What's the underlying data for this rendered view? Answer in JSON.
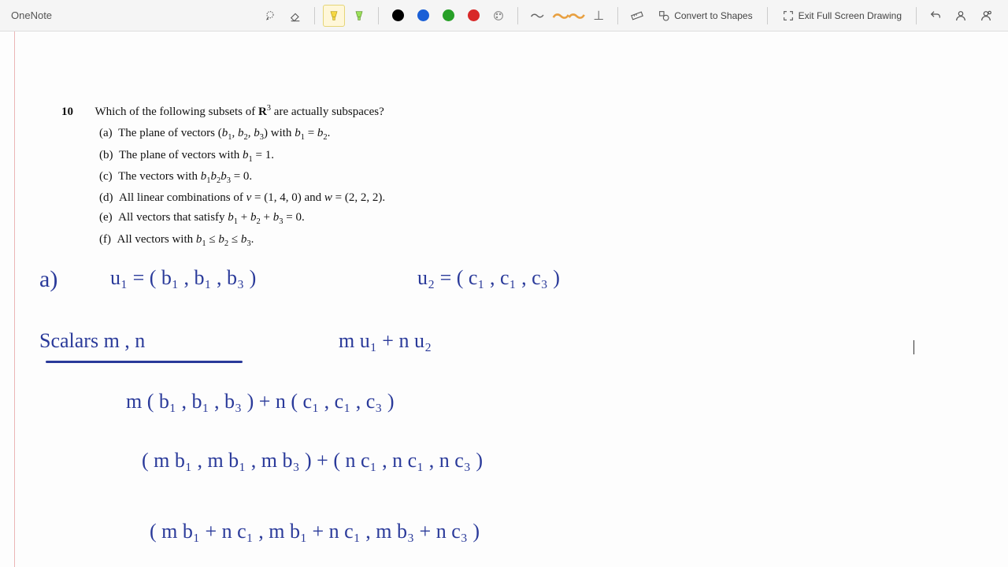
{
  "app": {
    "name": "OneNote"
  },
  "toolbar": {
    "lasso": "Lasso Select",
    "eraser": "Eraser",
    "hl1": "Highlighter Yellow",
    "hl2": "Highlighter Green",
    "colors": {
      "black": "#000000",
      "blue": "#1a5fd6",
      "green": "#28a028",
      "red": "#d82828"
    },
    "customPen": "Custom Pen",
    "ruler": "Ruler",
    "convert": "Convert to Shapes",
    "exit": "Exit Full Screen Drawing",
    "undo": "Undo",
    "user": "User",
    "share": "Share"
  },
  "problem": {
    "num": "10",
    "question_lead": "Which of the following subsets of ",
    "question_tail": " are actually subspaces?",
    "a": "The plane of vectors (b₁, b₂, b₃) with b₁ = b₂.",
    "b": "The plane of vectors with b₁ = 1.",
    "c": "The vectors with b₁b₂b₃ = 0.",
    "d": "All linear combinations of v = (1, 4, 0) and w = (2, 2, 2).",
    "e": "All vectors that satisfy b₁ + b₂ + b₃ = 0.",
    "f": "All vectors with b₁ ≤ b₂ ≤ b₃."
  },
  "hand": {
    "l1a": "a)",
    "l1b": "u₁  =  ( b₁ , b₁ , b₃ )",
    "l1c": "u₂  =  ( c₁ , c₁ , c₃ )",
    "l2a": "Scalars    m , n",
    "l2b": "m u₁  +  n u₂",
    "l3": "m ( b₁ , b₁ , b₃ )   +   n ( c₁ , c₁ , c₃ )",
    "l4": "( m b₁ , m b₁ , m b₃ )   +  ( n c₁ , n c₁ , n c₃ )",
    "l5": "( m b₁ + n c₁ ,  m b₁ + n c₁ ,  m b₃ + n c₃ )"
  }
}
